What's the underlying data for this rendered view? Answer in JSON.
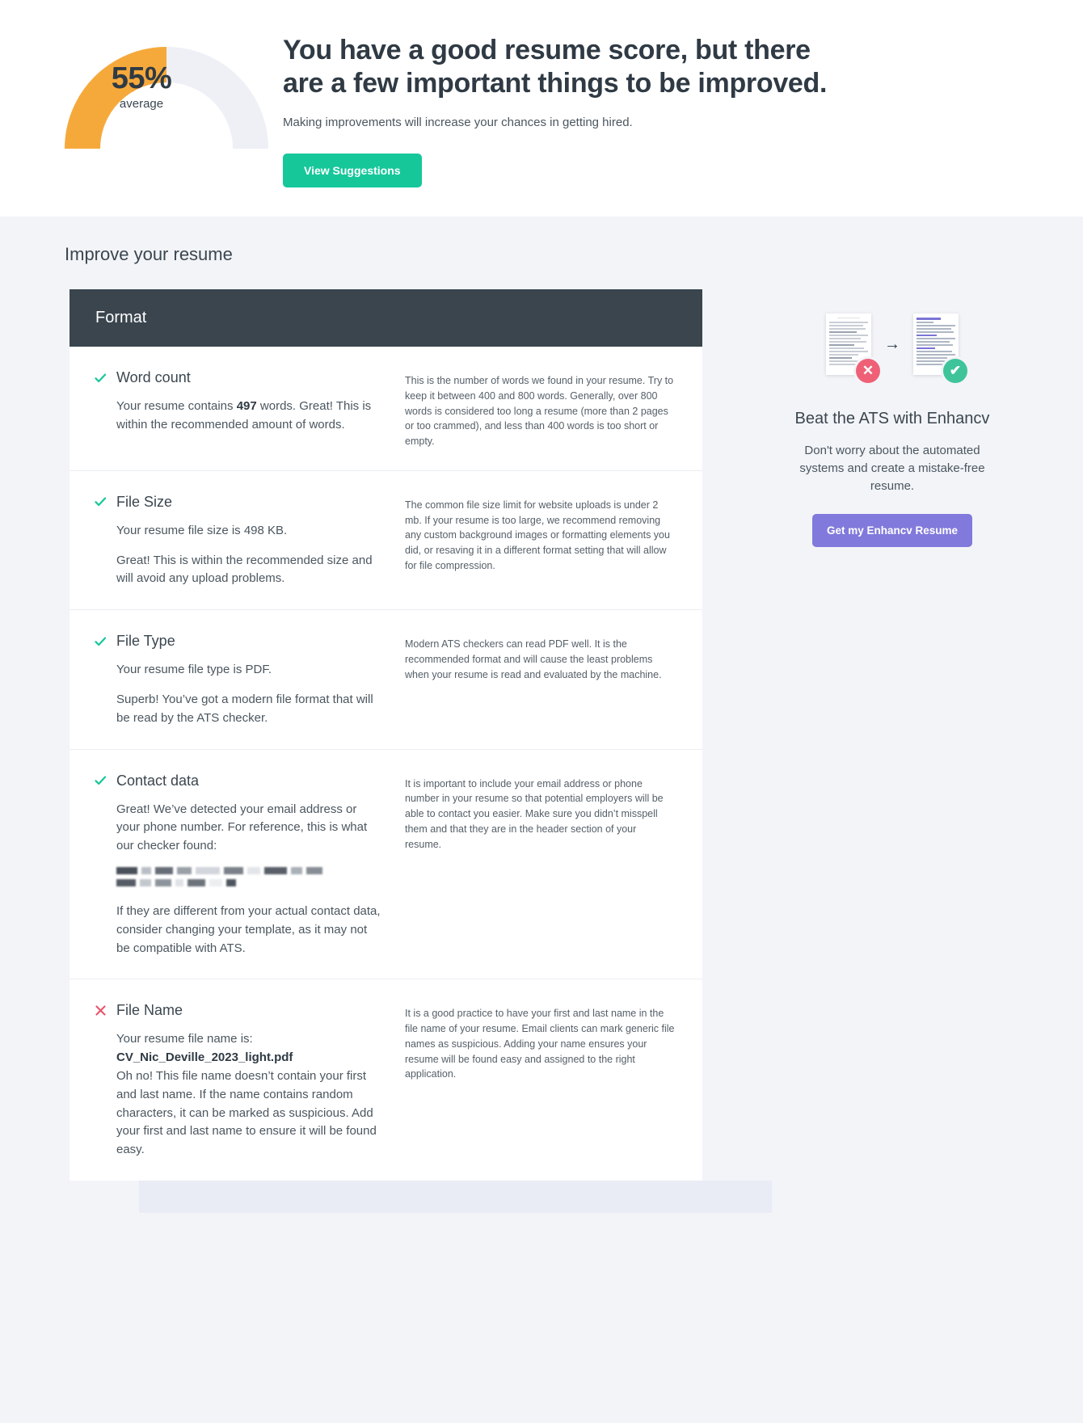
{
  "hero": {
    "gauge": {
      "percent": 55,
      "percent_label": "55%",
      "sub_label": "average",
      "arc_color": "#f6a93b",
      "track_color": "#eef0f6"
    },
    "title": "You have a good resume score, but there are a few important things to be improved.",
    "subtitle": "Making improvements will increase your chances in getting hired.",
    "cta_label": "View Suggestions",
    "cta_color": "#16c79a"
  },
  "section": {
    "heading": "Improve your resume",
    "card_header": "Format"
  },
  "checks": [
    {
      "status": "pass",
      "icon": "check-icon",
      "title": "Word count",
      "body_html": "Your resume contains <b>497</b> words. Great! This is within the recommended amount of words.",
      "body_text": "Your resume contains 497 words. Great! This is within the recommended amount of words.",
      "value": "497",
      "description": "This is the number of words we found in your resume. Try to keep it between 400 and 800 words. Generally, over 800 words is considered too long a resume (more than 2 pages or too crammed), and less than 400 words is too short or empty."
    },
    {
      "status": "pass",
      "icon": "check-icon",
      "title": "File Size",
      "body_line1": "Your resume file size is 498 KB.",
      "body_line2": "Great! This is within the recommended size and will avoid any upload problems.",
      "value": "498 KB",
      "description": "The common file size limit for website uploads is under 2 mb. If your resume is too large, we recommend removing any custom background images or formatting elements you did, or resaving it in a different format setting that will allow for file compression."
    },
    {
      "status": "pass",
      "icon": "check-icon",
      "title": "File Type",
      "body_line1": "Your resume file type is PDF.",
      "body_line2": "Superb! You’ve got a modern file format that will be read by the ATS checker.",
      "value": "PDF",
      "description": "Modern ATS checkers can read PDF well. It is the recommended format and will cause the least problems when your resume is read and evaluated by the machine."
    },
    {
      "status": "pass",
      "icon": "check-icon",
      "title": "Contact data",
      "body_line1": "Great! We’ve detected your email address or your phone number. For reference, this is what our checker found:",
      "redacted_label": "redacted contact details",
      "body_line2": "If they are different from your actual contact data, consider changing your template, as it may not be compatible with ATS.",
      "description": "It is important to include your email address or phone number in your resume so that potential employers will be able to contact you easier. Make sure you didn’t misspell them and that they are in the header section of your resume."
    },
    {
      "status": "fail",
      "icon": "x-icon",
      "title": "File Name",
      "body_line1": "Your resume file name is:",
      "filename": "CV_Nic_Deville_2023_light.pdf",
      "body_line2": "Oh no! This file name doesn’t contain your first and last name. If the name contains random characters, it can be marked as suspicious. Add your first and last name to ensure it will be found easy.",
      "description": "It is a good practice to have your first and last name in the file name of your resume. Email clients can mark generic file names as suspicious. Adding your name ensures your resume will be found easy and assigned to the right application."
    }
  ],
  "promo": {
    "title": "Beat the ATS with Enhancv",
    "text": "Don't worry about the automated systems and create a mistake-free resume.",
    "cta_label": "Get my Enhancv Resume",
    "cta_color": "#8179db",
    "bad_badge": "✕",
    "good_badge": "✔",
    "arrow": "→"
  },
  "colors": {
    "pass": "#16c79a",
    "fail": "#e8536b",
    "header_bar": "#3a454e",
    "page_bg": "#f2f4f8"
  }
}
